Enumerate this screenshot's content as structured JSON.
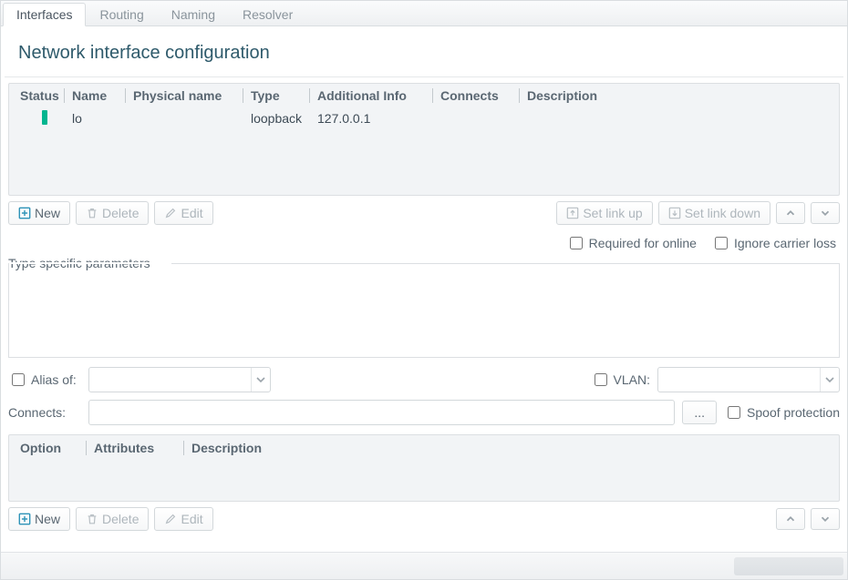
{
  "tabs": [
    "Interfaces",
    "Routing",
    "Naming",
    "Resolver"
  ],
  "page_title": "Network interface configuration",
  "grid": {
    "headers": {
      "status": "Status",
      "name": "Name",
      "phys": "Physical name",
      "type": "Type",
      "addl": "Additional Info",
      "conn": "Connects",
      "desc": "Description"
    },
    "rows": [
      {
        "status": "up",
        "name": "lo",
        "phys": "",
        "type": "loopback",
        "addl": "127.0.0.1",
        "conn": "",
        "desc": ""
      }
    ]
  },
  "toolbar": {
    "new": "New",
    "delete": "Delete",
    "edit": "Edit",
    "linkup": "Set link up",
    "linkdown": "Set link down"
  },
  "checks": {
    "required_online": "Required for online",
    "ignore_carrier": "Ignore carrier loss"
  },
  "params_label": "Type specific parameters",
  "form": {
    "alias_of": "Alias of:",
    "vlan": "VLAN:",
    "connects": "Connects:",
    "browse": "...",
    "spoof": "Spoof protection"
  },
  "subgrid": {
    "headers": {
      "option": "Option",
      "attributes": "Attributes",
      "description": "Description"
    }
  }
}
